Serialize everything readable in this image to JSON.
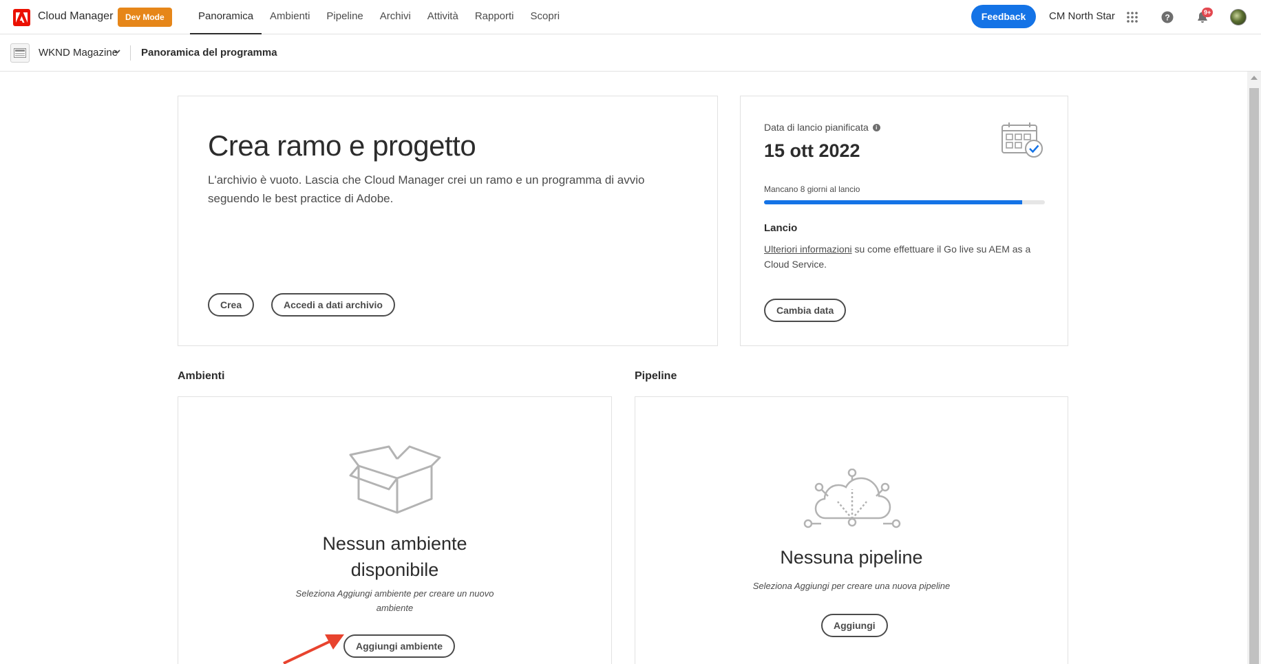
{
  "topbar": {
    "app_name": "Cloud Manager",
    "dev_mode": "Dev Mode",
    "nav": [
      "Panoramica",
      "Ambienti",
      "Pipeline",
      "Archivi",
      "Attività",
      "Rapporti",
      "Scopri"
    ],
    "active_nav": "Panoramica",
    "feedback": "Feedback",
    "org": "CM North Star",
    "notification_count": "9+"
  },
  "subbar": {
    "program_name": "WKND Magazine",
    "page": "Panoramica del programma"
  },
  "hero": {
    "title": "Crea ramo e progetto",
    "text": "L'archivio è vuoto. Lascia che Cloud Manager crei un ramo e un programma di avvio seguendo le best practice di Adobe.",
    "create_label": "Crea",
    "access_label": "Accedi a dati archivio"
  },
  "launch": {
    "label": "Data di lancio pianificata",
    "date": "15 ott 2022",
    "days_left": "Mancano 8 giorni al lancio",
    "progress_fraction": 0.92,
    "heading": "Lancio",
    "link_text": "Ulteriori informazioni",
    "text_rest": " su come effettuare il Go live su AEM as a Cloud Service.",
    "change_label": "Cambia data"
  },
  "environments": {
    "heading": "Ambienti",
    "empty_title_line1": "Nessun ambiente",
    "empty_title_line2": "disponibile",
    "empty_desc_line1": "Seleziona Aggiungi ambiente per creare un nuovo",
    "empty_desc_line2": "ambiente",
    "add_label": "Aggiungi ambiente"
  },
  "pipelines": {
    "heading": "Pipeline",
    "empty_title": "Nessuna pipeline",
    "empty_desc": "Seleziona Aggiungi per creare una nuova pipeline",
    "add_label": "Aggiungi"
  },
  "colors": {
    "accent": "#1473e6",
    "devmode": "#e68619",
    "adobe_red": "#eb1000",
    "annotation_arrow": "#e8432e"
  }
}
